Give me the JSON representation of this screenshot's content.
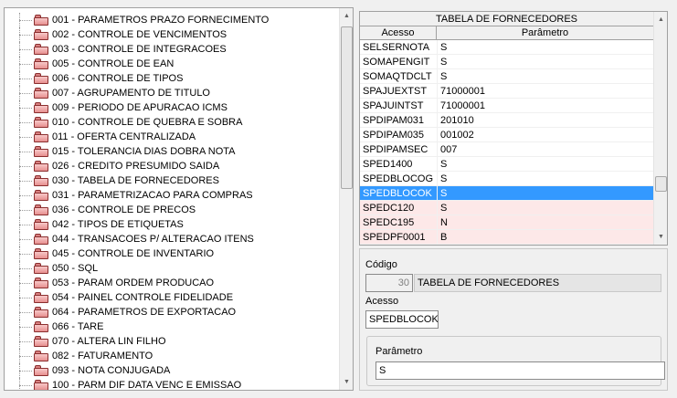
{
  "tree": {
    "items": [
      "001 - PARAMETROS PRAZO FORNECIMENTO",
      "002 - CONTROLE DE VENCIMENTOS",
      "003 - CONTROLE DE INTEGRACOES",
      "005 - CONTROLE DE EAN",
      "006 - CONTROLE DE TIPOS",
      "007 - AGRUPAMENTO DE TITULO",
      "009 - PERIODO DE APURACAO ICMS",
      "010 - CONTROLE DE QUEBRA E SOBRA",
      "011 - OFERTA CENTRALIZADA",
      "015 - TOLERANCIA DIAS DOBRA NOTA",
      "026 - CREDITO PRESUMIDO SAIDA",
      "030 - TABELA DE FORNECEDORES",
      "031 - PARAMETRIZACAO PARA COMPRAS",
      "036 - CONTROLE DE PRECOS",
      "042 - TIPOS DE ETIQUETAS",
      "044 - TRANSACOES P/ ALTERACAO ITENS",
      "045 - CONTROLE DE INVENTARIO",
      "050 - SQL",
      "053 - PARAM ORDEM PRODUCAO",
      "054 - PAINEL CONTROLE FIDELIDADE",
      "064 - PARAMETROS DE EXPORTACAO",
      "066 - TARE",
      "070 - ALTERA LIN FILHO",
      "082 - FATURAMENTO",
      "093 - NOTA CONJUGADA",
      "100 - PARM DIF DATA VENC E EMISSAO"
    ]
  },
  "grid": {
    "title": "TABELA DE FORNECEDORES",
    "col_acesso": "Acesso",
    "col_parametro": "Parâmetro",
    "rows": [
      {
        "acesso": "SELSERNOTA",
        "parametro": "S",
        "state": "normal"
      },
      {
        "acesso": "SOMAPENGIT",
        "parametro": "S",
        "state": "normal"
      },
      {
        "acesso": "SOMAQTDCLT",
        "parametro": "S",
        "state": "normal"
      },
      {
        "acesso": "SPAJUEXTST",
        "parametro": "71000001",
        "state": "normal"
      },
      {
        "acesso": "SPAJUINTST",
        "parametro": "71000001",
        "state": "normal"
      },
      {
        "acesso": "SPDIPAM031",
        "parametro": "201010",
        "state": "normal"
      },
      {
        "acesso": "SPDIPAM035",
        "parametro": "001002",
        "state": "normal"
      },
      {
        "acesso": "SPDIPAMSEC",
        "parametro": "007",
        "state": "normal"
      },
      {
        "acesso": "SPED1400",
        "parametro": "S",
        "state": "normal"
      },
      {
        "acesso": "SPEDBLOCOG",
        "parametro": "S",
        "state": "normal"
      },
      {
        "acesso": "SPEDBLOCOK",
        "parametro": "S",
        "state": "selected"
      },
      {
        "acesso": "SPEDC120",
        "parametro": "S",
        "state": "pink"
      },
      {
        "acesso": "SPEDC195",
        "parametro": "N",
        "state": "pink"
      },
      {
        "acesso": "SPEDPF0001",
        "parametro": "B",
        "state": "pink"
      }
    ]
  },
  "detail": {
    "codigo_label": "Código",
    "codigo_value": "30",
    "descricao_value": "TABELA DE FORNECEDORES",
    "acesso_label": "Acesso",
    "acesso_value": "SPEDBLOCOK",
    "parametro_label": "Parâmetro",
    "parametro_value": "S"
  },
  "colors": {
    "selection": "#3399ff",
    "pink_row": "#fde8e8",
    "folder": "#e78f8f"
  },
  "icons": {
    "tree_item": "folder-icon",
    "scroll_up": "arrow-up-icon",
    "scroll_down": "arrow-down-icon"
  }
}
